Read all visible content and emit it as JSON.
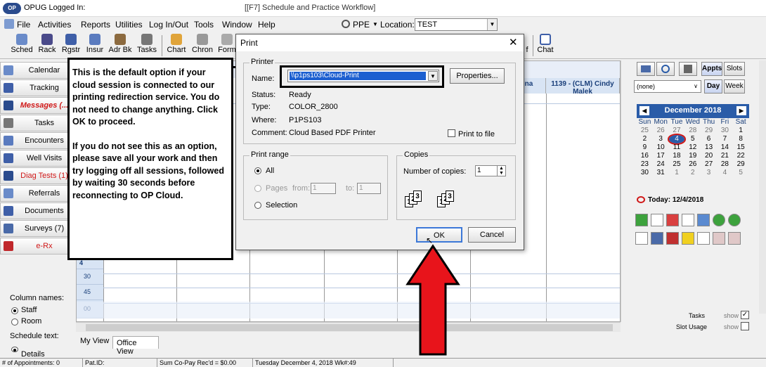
{
  "window": {
    "app_title": "OPUG Logged In:",
    "subtitle": "[[F7] Schedule and Practice Workflow]",
    "logo_text": "OP"
  },
  "menu": {
    "items": [
      "File",
      "Activities",
      "Reports",
      "Utilities",
      "Log In/Out",
      "Tools",
      "Window",
      "Help"
    ],
    "ppe_label": "PPE",
    "location_label": "Location:",
    "location_value": "TEST"
  },
  "toolbar": {
    "buttons": [
      "Sched",
      "Rack",
      "Rgstr",
      "Insur",
      "Adr Bk",
      "Tasks",
      "Chart",
      "Chron",
      "Form"
    ],
    "right_buttons": [
      "f",
      "Chat"
    ]
  },
  "nav": {
    "items": [
      "Calendar",
      "Tracking",
      "Messages (...",
      "Tasks",
      "Encounters",
      "Well Visits",
      "Diag Tests (1)",
      "Referrals",
      "Documents",
      "Surveys (7)",
      "e-Rx"
    ],
    "column_names_label": "Column names:",
    "radio_staff": "Staff",
    "radio_room": "Room",
    "schedule_text_label": "Schedule text:",
    "details_label": "Details"
  },
  "grid": {
    "headers": [
      "enna",
      "1139 - (CLM) Cindy Malek"
    ],
    "times": [
      "4",
      "30",
      "45",
      "00"
    ]
  },
  "tabs": {
    "my_view": "My View",
    "office_view": "Office View"
  },
  "right": {
    "appts": "Appts",
    "slots": "Slots",
    "none_value": "(none)",
    "day": "Day",
    "week": "Week",
    "month_title": "December 2018",
    "dow": [
      "Sun",
      "Mon",
      "Tue",
      "Wed",
      "Thu",
      "Fri",
      "Sat"
    ],
    "weeks": [
      [
        "25",
        "26",
        "27",
        "28",
        "29",
        "30",
        "1"
      ],
      [
        "2",
        "3",
        "4",
        "5",
        "6",
        "7",
        "8"
      ],
      [
        "9",
        "10",
        "11",
        "12",
        "13",
        "14",
        "15"
      ],
      [
        "16",
        "17",
        "18",
        "19",
        "20",
        "21",
        "22"
      ],
      [
        "23",
        "24",
        "25",
        "26",
        "27",
        "28",
        "29"
      ],
      [
        "30",
        "31",
        "1",
        "2",
        "3",
        "4",
        "5"
      ]
    ],
    "today_label": "Today: 12/4/2018",
    "tasks_label": "Tasks",
    "slot_usage_label": "Slot Usage",
    "show_label": "show"
  },
  "status": {
    "appointments": "# of Appointments: 0",
    "pat_id": "Pat.ID:",
    "copay": "Sum Co-Pay Rec'd = $0.00",
    "date": "Tuesday  December 4, 2018 Wk#:49"
  },
  "callout": {
    "para1": "This is the default option if your cloud session is connected to our printing redirection service. You do not need to change anything. Click OK to proceed.",
    "para2": "If you do not see this as an option, please save all your work and then try logging off all sessions, followed by waiting 30 seconds before reconnecting to OP Cloud."
  },
  "dialog": {
    "title": "Print",
    "printer_group": "Printer",
    "name_label": "Name:",
    "name_value": "\\\\p1ps103\\Cloud-Print",
    "properties_button": "Properties...",
    "status_label": "Status:",
    "status_value": "Ready",
    "type_label": "Type:",
    "type_value": "COLOR_2800",
    "where_label": "Where:",
    "where_value": "P1PS103",
    "comment_label": "Comment:",
    "comment_value": "Cloud Based PDF Printer",
    "print_to_file": "Print to file",
    "range_group": "Print range",
    "range_all": "All",
    "range_pages": "Pages",
    "from_label": "from:",
    "from_value": "1",
    "to_label": "to:",
    "to_value": "1",
    "range_selection": "Selection",
    "copies_group": "Copies",
    "copies_label": "Number of copies:",
    "copies_value": "1",
    "ok_button": "OK",
    "cancel_button": "Cancel"
  },
  "colors": {
    "accent_blue": "#2a5ca8",
    "arrow_red": "#e8141b",
    "selection_blue": "#1c5fd0"
  }
}
